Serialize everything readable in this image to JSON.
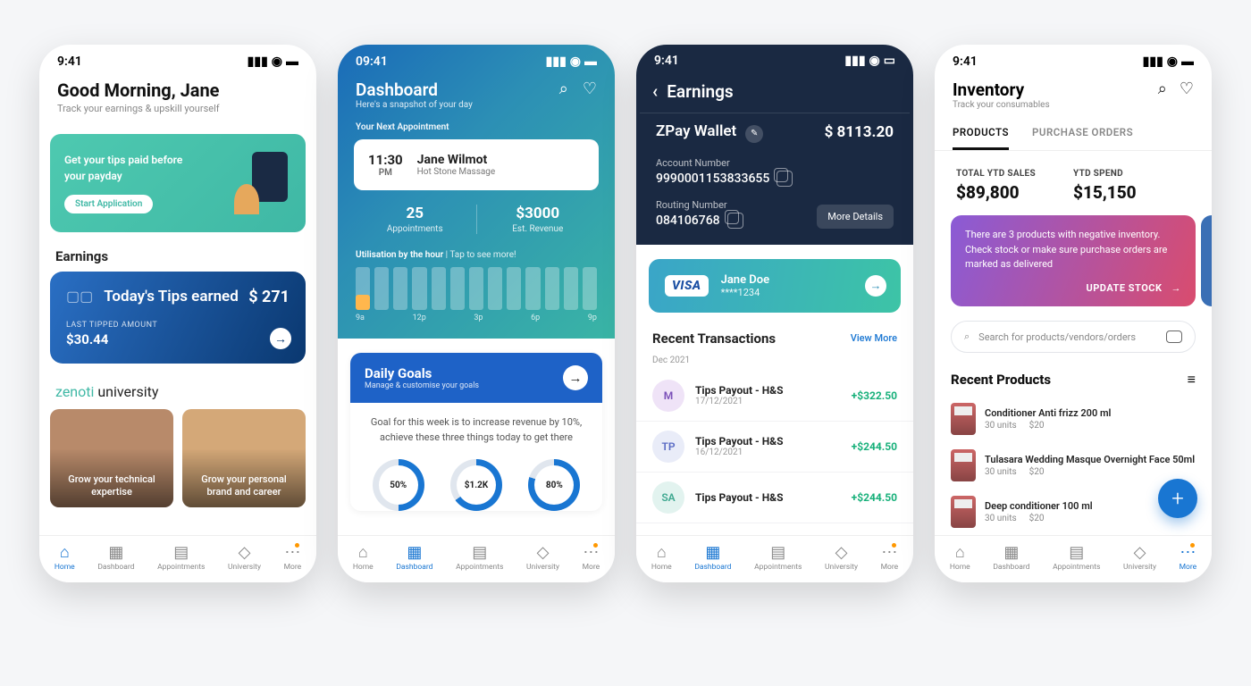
{
  "statusbar_time": "9:41",
  "statusbar_time_alt": "09:41",
  "nav": [
    "Home",
    "Dashboard",
    "Appointments",
    "University",
    "More"
  ],
  "s1": {
    "greeting": "Good Morning, Jane",
    "sub": "Track your earnings & upskill yourself",
    "banner_text": "Get your tips paid before your payday",
    "banner_cta": "Start Application",
    "earnings_label": "Earnings",
    "tips_label": "Today's Tips earned",
    "tips_value": "$ 271",
    "last_tipped_label": "LAST TIPPED AMOUNT",
    "last_tipped_value": "$30.44",
    "zuni_brand": "zenoti",
    "zuni_word": " university",
    "cards": [
      "Grow your technical expertise",
      "Grow your personal brand and career"
    ]
  },
  "s2": {
    "title": "Dashboard",
    "sub": "Here's a snapshot of your day",
    "next_appt_label": "Your Next Appointment",
    "appt_time": "11:30",
    "appt_period": "PM",
    "appt_name": "Jane Wilmot",
    "appt_service": "Hot Stone Massage",
    "stat_appts_val": "25",
    "stat_appts_lbl": "Appointments",
    "stat_rev_val": "$3000",
    "stat_rev_lbl": "Est. Revenue",
    "util_label": "Utilisation by the hour",
    "util_tap": " | Tap to see more!",
    "util_ticks": [
      "9a",
      "12p",
      "3p",
      "6p",
      "9p"
    ],
    "goals_title": "Daily Goals",
    "goals_sub": "Manage & customise your goals",
    "goals_body": "Goal for this week is to increase revenue by 10%, achieve these three things today to get there",
    "gauges": [
      "50%",
      "$1.2K",
      "80%"
    ]
  },
  "s3": {
    "title": "Earnings",
    "wallet_name": "ZPay Wallet",
    "wallet_balance": "$ 8113.20",
    "acct_label": "Account Number",
    "acct_value": "9990001153833655",
    "routing_label": "Routing Number",
    "routing_value": "084106768",
    "more": "More Details",
    "visa_brand": "VISA",
    "card_name": "Jane Doe",
    "card_last4": "****1234",
    "tx_title": "Recent Transactions",
    "tx_more": "View More",
    "tx_month": "Dec 2021",
    "tx": [
      {
        "initial": "M",
        "bg": "#efe3f7",
        "fg": "#7a4fb8",
        "name": "Tips Payout - H&S",
        "date": "17/12/2021",
        "amt": "+$322.50"
      },
      {
        "initial": "TP",
        "bg": "#e9ecf8",
        "fg": "#5a6bc4",
        "name": "Tips Payout - H&S",
        "date": "16/12/2021",
        "amt": "+$244.50"
      },
      {
        "initial": "SA",
        "bg": "#e2f3ef",
        "fg": "#3fa890",
        "name": "Tips Payout - H&S",
        "date": "",
        "amt": "+$244.50"
      }
    ]
  },
  "s4": {
    "title": "Inventory",
    "sub": "Track your consumables",
    "tabs": [
      "PRODUCTS",
      "PURCHASE ORDERS"
    ],
    "ytd_sales_lbl": "TOTAL YTD SALES",
    "ytd_sales_val": "$89,800",
    "ytd_spend_lbl": "YTD SPEND",
    "ytd_spend_val": "$15,150",
    "alert_text": "There are 3 products with negative inventory. Check stock or make sure purchase orders are marked as delivered",
    "alert_cta": "UPDATE STOCK",
    "search_placeholder": "Search for products/vendors/orders",
    "recent_title": "Recent Products",
    "products": [
      {
        "name": "Conditioner Anti frizz 200 ml",
        "units": "30 units",
        "price": "$20"
      },
      {
        "name": "Tulasara Wedding Masque Overnight Face 50ml",
        "units": "30 units",
        "price": "$20"
      },
      {
        "name": "Deep conditioner 100 ml",
        "units": "30 units",
        "price": "$20"
      }
    ]
  }
}
